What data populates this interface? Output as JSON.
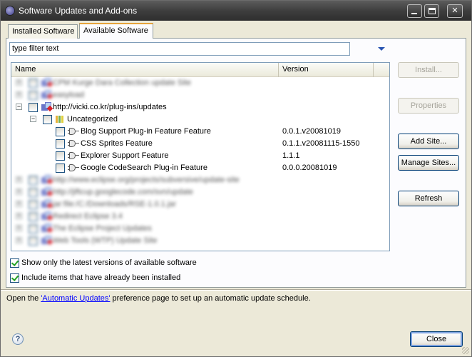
{
  "window": {
    "title": "Software Updates and Add-ons",
    "controls": {
      "minimize": "",
      "maximize": "",
      "close": "✕"
    }
  },
  "tabs": [
    {
      "label": "Installed Software",
      "active": false
    },
    {
      "label": "Available Software",
      "active": true
    }
  ],
  "filter": {
    "value": "type filter text"
  },
  "tree": {
    "columns": {
      "name": "Name",
      "version": "Version"
    },
    "rows": [
      {
        "kind": "site",
        "label": "CPM Kurge Dara Collection update Site",
        "version": "",
        "blurred": true
      },
      {
        "kind": "site",
        "label": "easyload",
        "version": "",
        "blurred": true
      },
      {
        "kind": "site",
        "label": "http://vicki.co.kr/plug-ins/updates",
        "version": "",
        "expanded": true,
        "blurred": false
      },
      {
        "kind": "category",
        "label": "Uncategorized",
        "version": "",
        "expanded": true,
        "blurred": false
      },
      {
        "kind": "feature",
        "label": "Blog Support Plug-in Feature Feature",
        "version": "0.0.1.v20081019",
        "blurred": false
      },
      {
        "kind": "feature",
        "label": "CSS Sprites Feature",
        "version": "0.1.1.v20081115-1550",
        "blurred": false
      },
      {
        "kind": "feature",
        "label": "Explorer Support Feature",
        "version": "1.1.1",
        "blurred": false
      },
      {
        "kind": "feature",
        "label": "Google CodeSearch Plug-in Feature",
        "version": "0.0.0.20081019",
        "blurred": false
      },
      {
        "kind": "site",
        "label": "http://www.eclipse.org/projects/subversive/update-site",
        "version": "",
        "blurred": true
      },
      {
        "kind": "site",
        "label": "http://jiftcup.googlecode.com/svn/update",
        "version": "",
        "blurred": true
      },
      {
        "kind": "site",
        "label": "jar:file:/C:/Downloads/RSE-1.0.1.jar",
        "version": "",
        "blurred": true
      },
      {
        "kind": "site",
        "label": "Redirect Eclipse 3.4",
        "version": "",
        "blurred": true
      },
      {
        "kind": "site",
        "label": "The Eclipse Project Updates",
        "version": "",
        "blurred": true
      },
      {
        "kind": "site",
        "label": "Web Tools (WTP) Update Site",
        "version": "",
        "blurred": true
      }
    ]
  },
  "buttons": {
    "install": {
      "label": "Install...",
      "enabled": false
    },
    "properties": {
      "label": "Properties",
      "enabled": false
    },
    "add_site": {
      "label": "Add Site...",
      "enabled": true
    },
    "manage_sites": {
      "label": "Manage Sites...",
      "enabled": true
    },
    "refresh": {
      "label": "Refresh",
      "enabled": true
    }
  },
  "options": {
    "latest_only": {
      "label": "Show only the latest versions of available software",
      "checked": true
    },
    "include_installed": {
      "label": "Include items that have already been installed",
      "checked": true
    }
  },
  "info": {
    "prefix": "Open the ",
    "link": "'Automatic Updates'",
    "suffix": " preference page to set up an automatic update schedule."
  },
  "footer": {
    "help": "?",
    "close_label": "Close"
  },
  "colors": {
    "accent_tab": "#e6a33b",
    "link": "#0000ff",
    "titlebar": "#3e3e3e"
  }
}
